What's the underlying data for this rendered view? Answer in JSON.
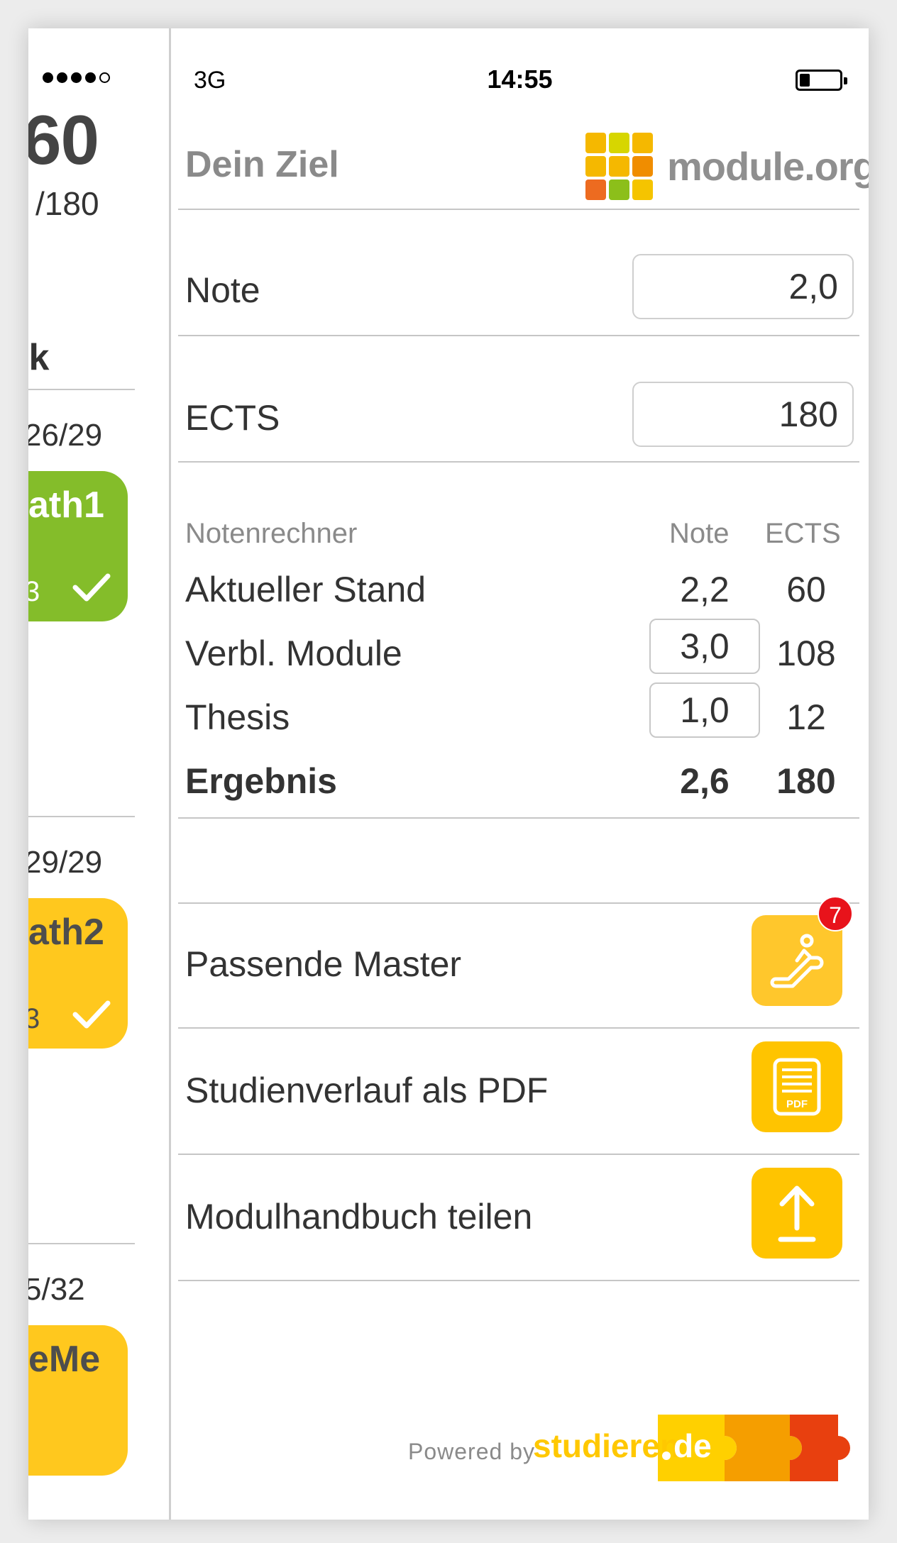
{
  "status_bar": {
    "carrier": "3G",
    "time": "14:55"
  },
  "left_panel": {
    "total_ects": "60",
    "total_max": "/180",
    "section_title_fragment": "ik",
    "semesters": [
      {
        "count": "26/29",
        "module_label": "ath1",
        "module_small": "3",
        "color": "#84bd2a",
        "text_color": "#ffffff"
      },
      {
        "count": "29/29",
        "module_label": "ath2",
        "module_small": "3",
        "color": "#ffc81e",
        "text_color": "#4d4d4d"
      },
      {
        "count": "5/32",
        "module_label": "eMe",
        "module_small": "",
        "color": "#ffc81e",
        "text_color": "#4d4d4d"
      }
    ]
  },
  "header": {
    "title": "Dein Ziel",
    "logo_text": "module.org",
    "logo_colors": [
      "#f5b800",
      "#d7d600",
      "#f5b800",
      "#f5b800",
      "#f5b800",
      "#f08d00",
      "#ed6b20",
      "#8cbf1a",
      "#f5c400"
    ]
  },
  "goal": {
    "note_label": "Note",
    "note_value": "2,0",
    "ects_label": "ECTS",
    "ects_value": "180"
  },
  "calculator": {
    "title": "Notenrechner",
    "col_note": "Note",
    "col_ects": "ECTS",
    "rows": [
      {
        "label": "Aktueller Stand",
        "note": "2,2",
        "ects": "60",
        "editable": false
      },
      {
        "label": "Verbl. Module",
        "note": "3,0",
        "ects": "108",
        "editable": true
      },
      {
        "label": "Thesis",
        "note": "1,0",
        "ects": "12",
        "editable": true
      }
    ],
    "result": {
      "label": "Ergebnis",
      "note": "2,6",
      "ects": "180"
    }
  },
  "actions": [
    {
      "label": "Passende Master",
      "icon": "escalator-icon",
      "badge": "7"
    },
    {
      "label": "Studienverlauf als PDF",
      "icon": "pdf-document-icon",
      "pdf_text": "PDF"
    },
    {
      "label": "Modulhandbuch teilen",
      "icon": "share-upload-icon"
    }
  ],
  "footer": {
    "powered_by": "Powered by",
    "brand_name": "studieren",
    "brand_tld": "de"
  }
}
